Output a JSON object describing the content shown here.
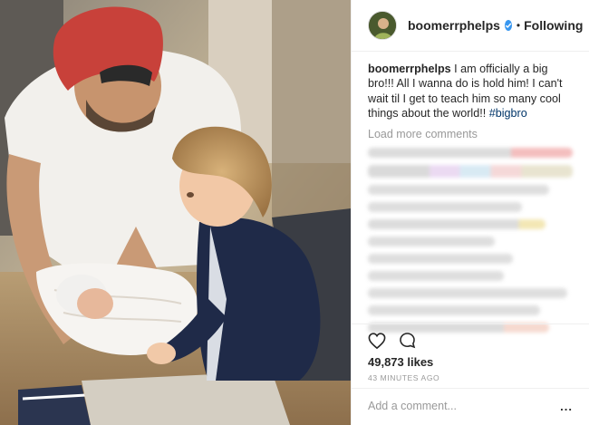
{
  "post": {
    "username": "boomerrphelps",
    "follow_separator": "•",
    "follow_status": "Following",
    "caption_user": "boomerrphelps",
    "caption_text": "I am officially a big bro!!! All I wanna do is hold him! I can't wait til I get to teach him so many cool things about the world!!",
    "caption_hashtag": "#bigbro",
    "load_more": "Load more comments",
    "likes": "49,873 likes",
    "time": "43 MINUTES AGO",
    "add_comment_placeholder": "Add a comment...",
    "more_options": "..."
  },
  "icons": {
    "verified": "verified-badge-icon",
    "like": "heart-icon",
    "comment": "comment-bubble-icon"
  },
  "colors": {
    "verified_blue": "#3897f0",
    "hashtag": "#003569",
    "muted": "#999999",
    "text": "#262626"
  }
}
